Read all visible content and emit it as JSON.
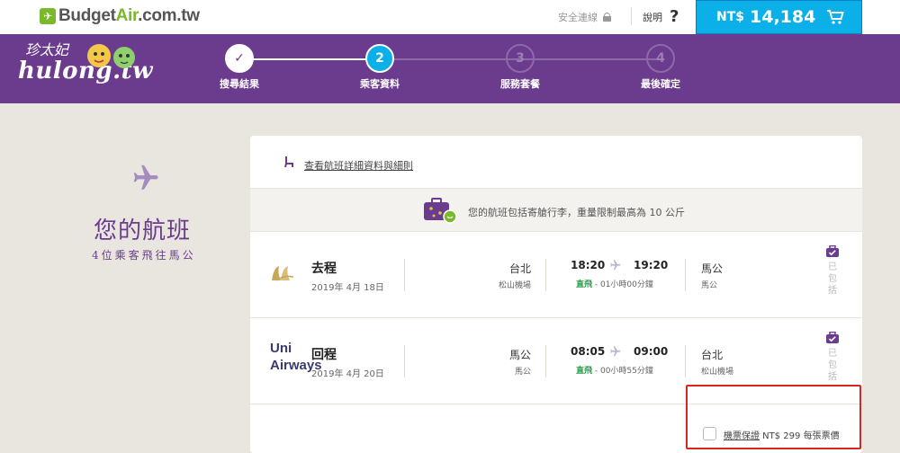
{
  "topbar": {
    "logo": {
      "budget": "Budget",
      "air": "Air",
      "domain": ".com.tw"
    },
    "secure_label": "安全連線",
    "help_label": "說明",
    "help_icon": "?",
    "cart": {
      "currency": "NT$",
      "amount": "14,184"
    }
  },
  "brand": {
    "cn": "珍太妃",
    "en": "hulong.tw"
  },
  "steps": [
    {
      "label": "搜尋結果",
      "num": "✓",
      "state": "done"
    },
    {
      "label": "乘客資料",
      "num": "2",
      "state": "active"
    },
    {
      "label": "服務套餐",
      "num": "3",
      "state": "todo"
    },
    {
      "label": "最後確定",
      "num": "4",
      "state": "todo"
    }
  ],
  "left": {
    "title": "您的航班",
    "subtitle": "4位乘客飛往馬公"
  },
  "card": {
    "details_link": "查看航班詳細資料與細則",
    "baggage_text": "您的航班包括寄艙行李，重量限制最高為 10 公斤",
    "legs": [
      {
        "direction": "去程",
        "date": "2019年 4月 18日",
        "from_city": "台北",
        "from_airport": "松山機場",
        "dep_time": "18:20",
        "arr_time": "19:20",
        "direct": "直飛",
        "duration": " - 01小時00分鐘",
        "to_city": "馬公",
        "to_airport": "馬公",
        "included": [
          "已",
          "包",
          "括"
        ]
      },
      {
        "direction": "回程",
        "airline_name_1": "Uni",
        "airline_name_2": "Airways",
        "date": "2019年 4月 20日",
        "from_city": "馬公",
        "from_airport": "馬公",
        "dep_time": "08:05",
        "arr_time": "09:00",
        "direct": "直飛",
        "duration": " - 00小時55分鐘",
        "to_city": "台北",
        "to_airport": "松山機場",
        "included": [
          "已",
          "包",
          "括"
        ]
      }
    ],
    "insurance": {
      "link": "機票保證",
      "price": " NT$ 299 每張票價"
    }
  },
  "colors": {
    "purple": "#6b3b8e",
    "cart_blue": "#0bb0e8",
    "logo_green": "#7ab929",
    "direct_green": "#2a9d4a",
    "highlight_red": "#d9251c"
  }
}
